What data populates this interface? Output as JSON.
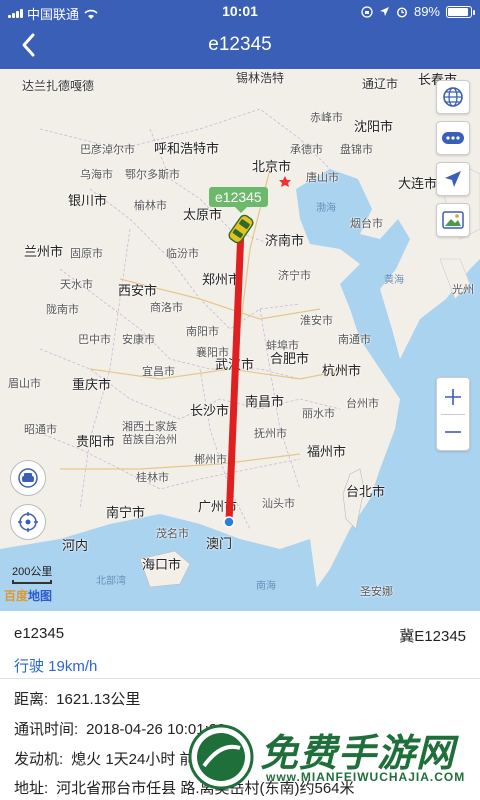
{
  "status_bar": {
    "carrier": "中国联通",
    "time": "10:01",
    "battery": "89%",
    "battery_level": 0.89
  },
  "nav": {
    "title": "e12345"
  },
  "map": {
    "device_label": "e12345",
    "scale": "200公里",
    "provider": "百度",
    "provider_suffix": "地图",
    "cities": {
      "dalanzade": "达兰扎德嘎德",
      "xilinhaote": "锡林浩特",
      "tongliao": "通辽市",
      "changchun": "长春市",
      "chifeng": "赤峰市",
      "shenyang": "沈阳市",
      "bayannur": "巴彦淖尔市",
      "huhehaote": "呼和浩特市",
      "chengde": "承德市",
      "panjin": "盘锦市",
      "wuhai": "乌海市",
      "ordos": "鄂尔多斯市",
      "beijing": "北京市",
      "tangshan": "唐山市",
      "dalian": "大连市",
      "yinchuan": "银川市",
      "yulin": "榆林市",
      "taiyuan": "太原市",
      "jinan": "济南市",
      "yantai": "烟台市",
      "bohai": "渤海",
      "lanzhou": "兰州市",
      "guyuan": "固原市",
      "linfen": "临汾市",
      "jining": "济宁市",
      "tianshui": "天水市",
      "zhengzhou": "郑州市",
      "xian": "西安市",
      "yellow_sea": "黄海",
      "longnan": "陇南市",
      "shangluo": "商洛市",
      "nanyang": "南阳市",
      "huaian": "淮安市",
      "guangzhou_n": "光州",
      "bazhong": "巴中市",
      "ankang": "安康市",
      "xiangyang": "襄阳市",
      "bengbu": "蚌埠市",
      "nantong": "南通市",
      "yichang": "宜昌市",
      "wuhan": "武汉市",
      "hefei": "合肥市",
      "hangzhou": "杭州市",
      "meishan": "眉山市",
      "chongqing": "重庆市",
      "changsha": "长沙市",
      "nanchang": "南昌市",
      "lishui": "丽水市",
      "taizhou": "台州市",
      "zhaotong": "昭通市",
      "xiangxi": "湘西土家族",
      "miaozu": "苗族自治州",
      "fuzhou_jx": "抚州市",
      "guiyang": "贵阳市",
      "fuzhou": "福州市",
      "chenzhou": "郴州市",
      "taipei": "台北市",
      "guilin": "桂林市",
      "guangzhou": "广州市",
      "shantou": "汕头市",
      "nanning": "南宁市",
      "maoming": "茂名市",
      "macau": "澳门",
      "hanoi": "河内",
      "haikou": "海口市",
      "beibuwan": "北部湾",
      "nanhai": "南海",
      "zhuhai_n": "圣安娜"
    }
  },
  "info": {
    "device_name": "e12345",
    "plate": "冀E12345",
    "status": "行驶 19km/h",
    "distance_label": "距离:",
    "distance_value": "1621.13公里",
    "comm_label": "通讯时间:",
    "comm_value": "2018-04-26 10:01:28",
    "engine_label": "发动机:",
    "engine_value": "熄火 1天24小时 前方 GPS",
    "address_label": "地址:",
    "address_value": "河北省邢台市任县 路.离吴岳村(东南)约564米"
  },
  "watermark": {
    "text": "免费手游网",
    "url": "www.MIANFEIWUCHAJIA.COM"
  },
  "colors": {
    "nav_bg": "#3a5fb6",
    "route": "#e02020",
    "speed_text": "#2a66d0",
    "device_label_bg": "#6cb96c",
    "land": "#f2efe9",
    "water": "#aad3f0"
  },
  "icons": [
    "back-arrow-icon",
    "wifi-icon",
    "location-arrow-icon",
    "alarm-icon",
    "globe-icon",
    "more-icon",
    "navigate-icon",
    "image-icon",
    "zoom-in-icon",
    "zoom-out-icon",
    "car-icon",
    "locate-target-icon"
  ]
}
